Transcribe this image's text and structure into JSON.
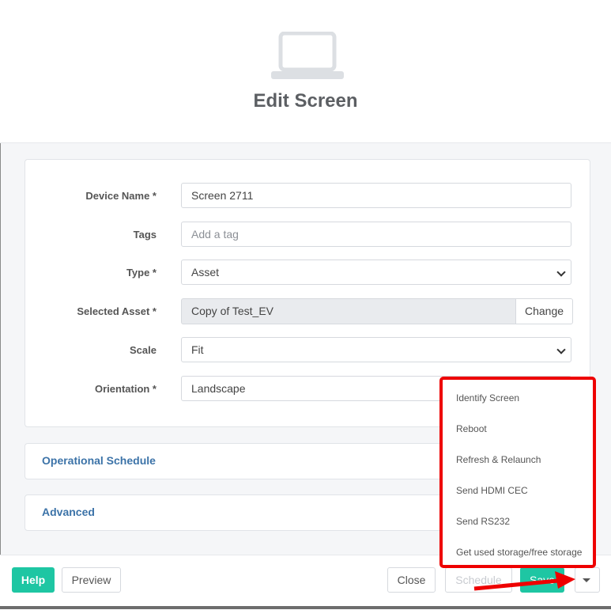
{
  "header": {
    "title": "Edit Screen",
    "icon": "laptop-icon"
  },
  "form": {
    "device_name": {
      "label": "Device Name *",
      "value": "Screen 2711"
    },
    "tags": {
      "label": "Tags",
      "placeholder": "Add a tag"
    },
    "type": {
      "label": "Type *",
      "value": "Asset"
    },
    "selected_asset": {
      "label": "Selected Asset *",
      "value": "Copy of Test_EV",
      "change_label": "Change"
    },
    "scale": {
      "label": "Scale",
      "value": "Fit"
    },
    "orientation": {
      "label": "Orientation *",
      "value": "Landscape"
    }
  },
  "panels": [
    {
      "title": "Operational Schedule"
    },
    {
      "title": "Advanced"
    }
  ],
  "footer": {
    "help": "Help",
    "preview": "Preview",
    "close": "Close",
    "schedule": "Schedule",
    "save": "Save"
  },
  "dropdown": {
    "items": [
      "Identify Screen",
      "Reboot",
      "Refresh & Relaunch",
      "Send HDMI CEC",
      "Send RS232",
      "Get used storage/free storage"
    ]
  },
  "colors": {
    "accent": "#1ec6a3",
    "link": "#3c73a8",
    "highlight": "#ee0000"
  }
}
